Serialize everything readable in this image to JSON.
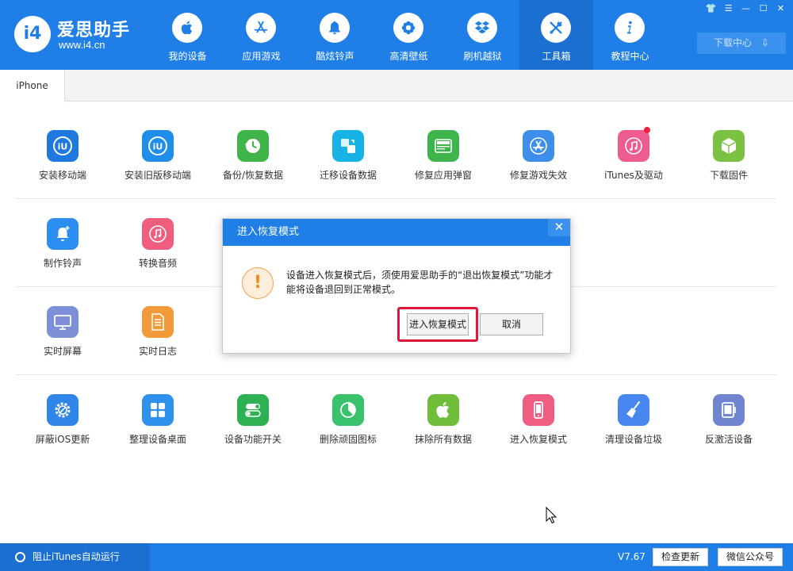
{
  "app": {
    "logo_mark": "i4",
    "logo_name": "爱思助手",
    "logo_url": "www.i4.cn"
  },
  "nav": [
    {
      "label": "我的设备",
      "icon": "apple-icon"
    },
    {
      "label": "应用游戏",
      "icon": "app-store-icon"
    },
    {
      "label": "酷炫铃声",
      "icon": "bell-icon"
    },
    {
      "label": "高清壁纸",
      "icon": "flower-icon"
    },
    {
      "label": "刷机越狱",
      "icon": "dropbox-icon"
    },
    {
      "label": "工具箱",
      "icon": "tools-icon",
      "active": true
    },
    {
      "label": "教程中心",
      "icon": "info-icon"
    }
  ],
  "window_controls": [
    "shirt-icon",
    "menu-icon",
    "minimize-icon",
    "maximize-icon",
    "close-icon"
  ],
  "download_center": "下载中心",
  "tab": {
    "label": "iPhone"
  },
  "tools_row1": [
    {
      "label": "安装移动端",
      "icon": "i4-logo-icon",
      "color": "#1e78e0"
    },
    {
      "label": "安装旧版移动端",
      "icon": "i4-logo-icon",
      "color": "#1e8ee8"
    },
    {
      "label": "备份/恢复数据",
      "icon": "backup-clock-icon",
      "color": "#3fb549"
    },
    {
      "label": "迁移设备数据",
      "icon": "migrate-icon",
      "color": "#18b3e6"
    },
    {
      "label": "修复应用弹窗",
      "icon": "apple-id-icon",
      "color": "#3eb54b"
    },
    {
      "label": "修复游戏失效",
      "icon": "app-store-icon",
      "color": "#3f8ee9"
    },
    {
      "label": "iTunes及驱动",
      "icon": "itunes-icon",
      "color": "#ee5b8f",
      "badge": true
    },
    {
      "label": "下载固件",
      "icon": "cube-icon",
      "color": "#7cc242"
    }
  ],
  "tools_row2": [
    {
      "label": "制作铃声",
      "icon": "bell-plus-icon",
      "color": "#2b8ef0"
    },
    {
      "label": "转换音频",
      "icon": "music-note-icon",
      "color": "#ef5e7d"
    }
  ],
  "tools_row3": [
    {
      "label": "实时屏幕",
      "icon": "monitor-icon",
      "color": "#7d8fd6"
    },
    {
      "label": "实时日志",
      "icon": "document-icon",
      "color": "#f29a3a"
    }
  ],
  "tools_row4": [
    {
      "label": "屏蔽iOS更新",
      "icon": "gear-block-icon",
      "color": "#2f86e8"
    },
    {
      "label": "整理设备桌面",
      "icon": "grid-icon",
      "color": "#2e92ec"
    },
    {
      "label": "设备功能开关",
      "icon": "toggle-icon",
      "color": "#2eb153"
    },
    {
      "label": "删除顽固图标",
      "icon": "pie-icon",
      "color": "#39c16b"
    },
    {
      "label": "抹除所有数据",
      "icon": "apple-icon",
      "color": "#6fbe3a"
    },
    {
      "label": "进入恢复模式",
      "icon": "phone-icon",
      "color": "#ef5d82"
    },
    {
      "label": "清理设备垃圾",
      "icon": "broom-icon",
      "color": "#4886f0"
    },
    {
      "label": "反激活设备",
      "icon": "tablet-icon",
      "color": "#6f85cf"
    }
  ],
  "dialog": {
    "title": "进入恢复模式",
    "warning_glyph": "!",
    "message": "设备进入恢复模式后，须使用爱思助手的“退出恢复模式”功能才能将设备退回到正常模式。",
    "confirm_label": "进入恢复模式",
    "cancel_label": "取消"
  },
  "status": {
    "itunes_label": "阻止iTunes自动运行",
    "version": "V7.67",
    "check_update": "检查更新",
    "wechat": "微信公众号"
  },
  "colors": {
    "brand_blue": "#1f7fe6",
    "active_nav": "#1a6fd0",
    "highlight_red": "#e0173a"
  }
}
